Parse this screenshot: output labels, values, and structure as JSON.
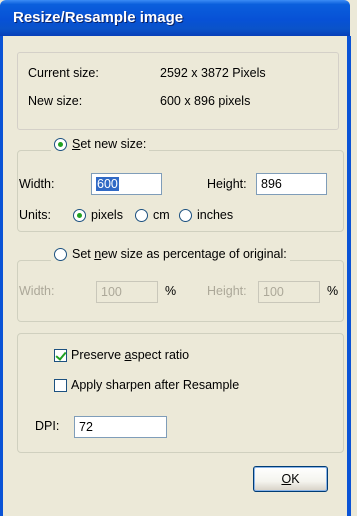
{
  "window": {
    "title": "Resize/Resample image"
  },
  "info": {
    "current_label": "Current size:",
    "current_value": "2592  x  3872  Pixels",
    "new_label": "New size:",
    "new_value": "600  x  896  pixels"
  },
  "set_size": {
    "legend_pre": "",
    "legend_ul": "S",
    "legend_post": "et new size:",
    "selected": true,
    "width_label_pre": "Width: ",
    "width_value": "600",
    "height_label": "Height:",
    "height_value": "896",
    "units_label": "Units:",
    "units": [
      {
        "label": "pixels",
        "selected": true
      },
      {
        "label": "cm",
        "selected": false
      },
      {
        "label": "inches",
        "selected": false
      }
    ]
  },
  "percent": {
    "legend_pre": "Set ",
    "legend_ul": "n",
    "legend_post": "ew size as percentage of original:",
    "selected": false,
    "width_label": "Width:",
    "width_value": "100",
    "width_unit": "%",
    "height_label": "Height:",
    "height_value": "100",
    "height_unit": "%"
  },
  "options": {
    "preserve_pre": "Preserve ",
    "preserve_ul": "a",
    "preserve_post": "spect ratio",
    "preserve_checked": true,
    "sharpen_label": "Apply sharpen after Resample",
    "sharpen_checked": false,
    "dpi_label": "DPI:",
    "dpi_value": "72"
  },
  "ok_button": {
    "label_ul": "O",
    "label_post": "K"
  },
  "colors": {
    "title_bar": "#0751d6",
    "dialog_bg": "#ece9d8",
    "radio_dot": "#21a121",
    "selection": "#316ac5"
  }
}
